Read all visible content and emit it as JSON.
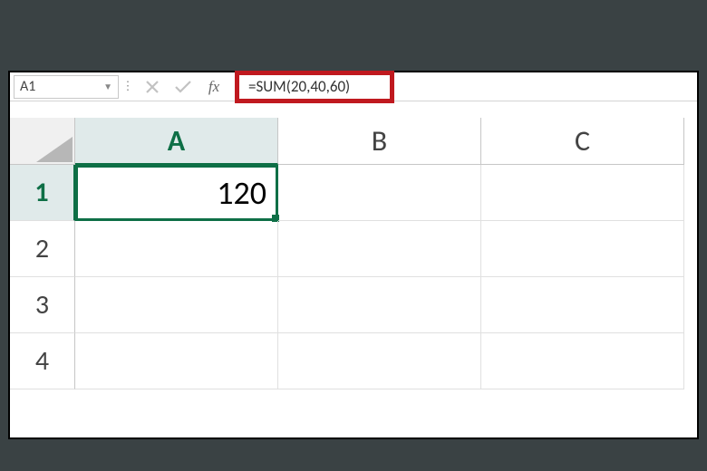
{
  "formula_bar": {
    "name_box": "A1",
    "fx_label": "fx",
    "formula": "=SUM(20,40,60)"
  },
  "columns": [
    "A",
    "B",
    "C"
  ],
  "rows": [
    "1",
    "2",
    "3",
    "4"
  ],
  "active_col_index": 0,
  "active_row_index": 0,
  "cells": {
    "A1": "120"
  }
}
